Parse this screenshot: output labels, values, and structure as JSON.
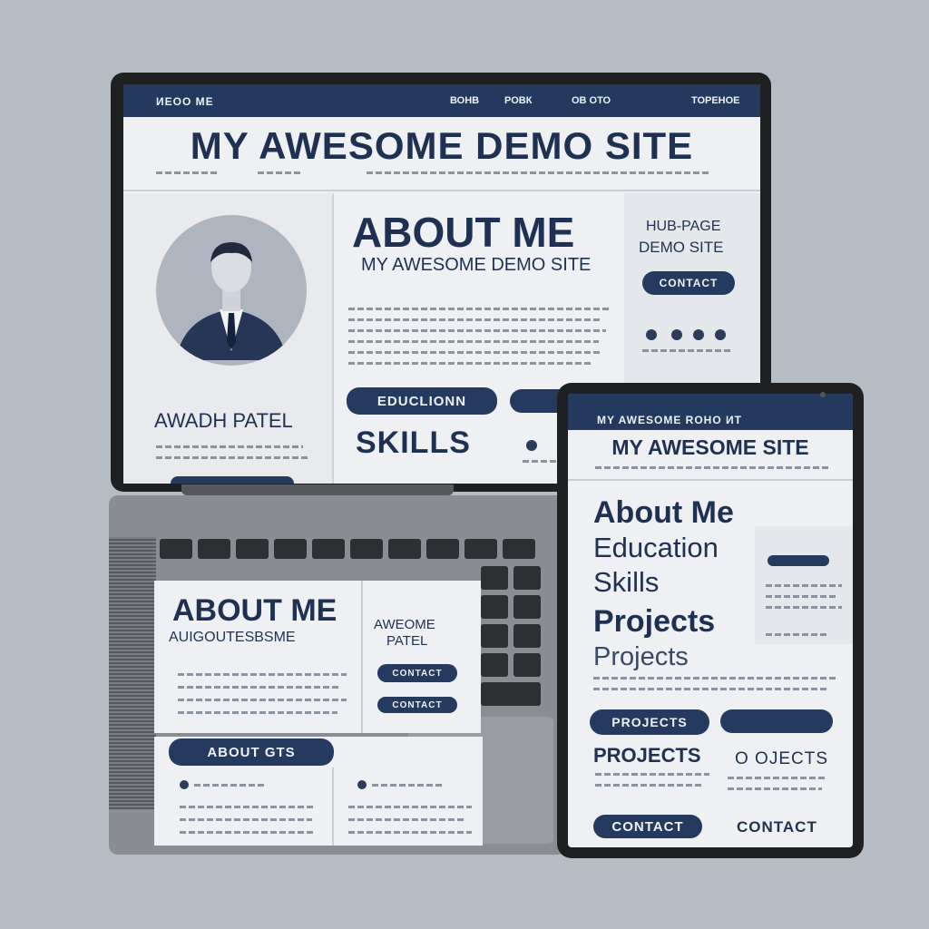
{
  "colors": {
    "navy": "#1f3152",
    "background": "#b6bcc4",
    "panel": "#eef0f3"
  },
  "laptop": {
    "nav": [
      "ИЕОО ME",
      "ВОНВ",
      "РОВК",
      "ОВ ОТО",
      "ТОРЕНОЕ"
    ],
    "site_title": "MY AWESOME DEMO SITE",
    "avatar_icon": "person-avatar-icon",
    "person_name": "AWADH PATEL",
    "about_heading": "ABOUT ME",
    "about_subheading": "MY AWESOME DEMO SITE",
    "side_title_1": "HUB-PAGE",
    "side_title_2": "DEMO SITE",
    "contact_button": "CONTACT",
    "education_button": "EDUCLIONN",
    "skills_heading": "SKILLS"
  },
  "base_card": {
    "about_heading": "ABOUT ME",
    "about_subheading": "AUIGOUTESBSME",
    "side_title_1": "AWEOME",
    "side_title_2": "PATEL",
    "button_1": "CONTACT",
    "button_2": "CONTACT",
    "about_button": "ABOUT GTS"
  },
  "tablet": {
    "nav": "MY AWESOME ROHO ИТ",
    "site_title": "MY AWESOME SITE",
    "menu_items": [
      "About Me",
      "Education",
      "Skills",
      "Projects",
      "Projects"
    ],
    "projects_button": "PROJECTS",
    "projects_heading": "PROJECTS",
    "objects_label": "O OJECTS",
    "contact_button": "CONTACT",
    "contact_link": "CONTACT"
  }
}
